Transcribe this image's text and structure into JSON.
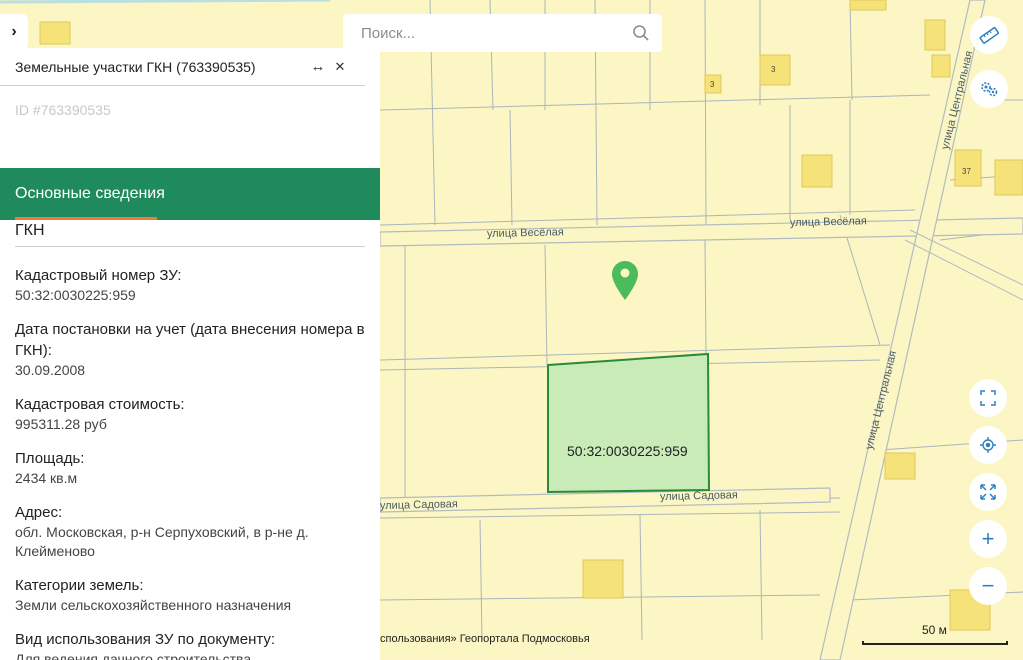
{
  "toggle": {
    "icon": "chevron-right-icon",
    "glyph": "›"
  },
  "search": {
    "placeholder": "Поиск...",
    "icon": "search-icon"
  },
  "panel": {
    "title": "Земельные участки ГКН (763390535)",
    "expand_glyph": "↔",
    "close_glyph": "✕",
    "id_text": "ID #763390535",
    "active_tab": "Основные сведения",
    "section_title": "ГКН",
    "fields": [
      {
        "label": "Кадастровый номер ЗУ:",
        "value": "50:32:0030225:959"
      },
      {
        "label": "Дата постановки на учет (дата внесения номера в ГКН):",
        "value": "30.09.2008"
      },
      {
        "label": "Кадастровая стоимость:",
        "value": "995311.28 руб"
      },
      {
        "label": "Площадь:",
        "value": "2434 кв.м"
      },
      {
        "label": "Адрес:",
        "value": "обл. Московская, р-н Серпуховский, в р-не д. Клейменово"
      },
      {
        "label": "Категории земель:",
        "value": "Земли сельскохозяйственного назначения"
      },
      {
        "label": "Вид использования ЗУ по документу:",
        "value": "Для ведения дачного строительства"
      }
    ]
  },
  "map": {
    "parcel_label": "50:32:0030225:959",
    "streets": {
      "vesyolaya_1": "улица Весёлая",
      "vesyolaya_2": "улица Весёлая",
      "sadovaya_1": "улица Садовая",
      "sadovaya_2": "улица Садовая",
      "centralnaya_1": "улица Центральная",
      "centralnaya_2": "улица Центральная"
    },
    "house_numbers": {
      "a": "3",
      "b": "3",
      "c": "37"
    },
    "scale_label": "50 м",
    "attribution": "спользования» Геопортала Подмосковья",
    "colors": {
      "parcel_fill": "#c8ebb8",
      "parcel_stroke": "#2a8a3a",
      "marker": "#4cbb5b",
      "panel_accent": "#1f8a5b",
      "tab_underline": "#f07a3a",
      "map_bg": "#fbf6c4"
    }
  },
  "map_controls": [
    {
      "name": "ruler-button",
      "icon": "ruler-icon"
    },
    {
      "name": "layers-settings-button",
      "icon": "gears-icon"
    },
    {
      "name": "fullscreen-button",
      "icon": "fullscreen-icon"
    },
    {
      "name": "locate-button",
      "icon": "locate-icon"
    },
    {
      "name": "fit-bounds-button",
      "icon": "expand-arrows-icon"
    },
    {
      "name": "zoom-in-button",
      "icon": "plus-icon",
      "glyph": "+"
    },
    {
      "name": "zoom-out-button",
      "icon": "minus-icon",
      "glyph": "−"
    }
  ]
}
